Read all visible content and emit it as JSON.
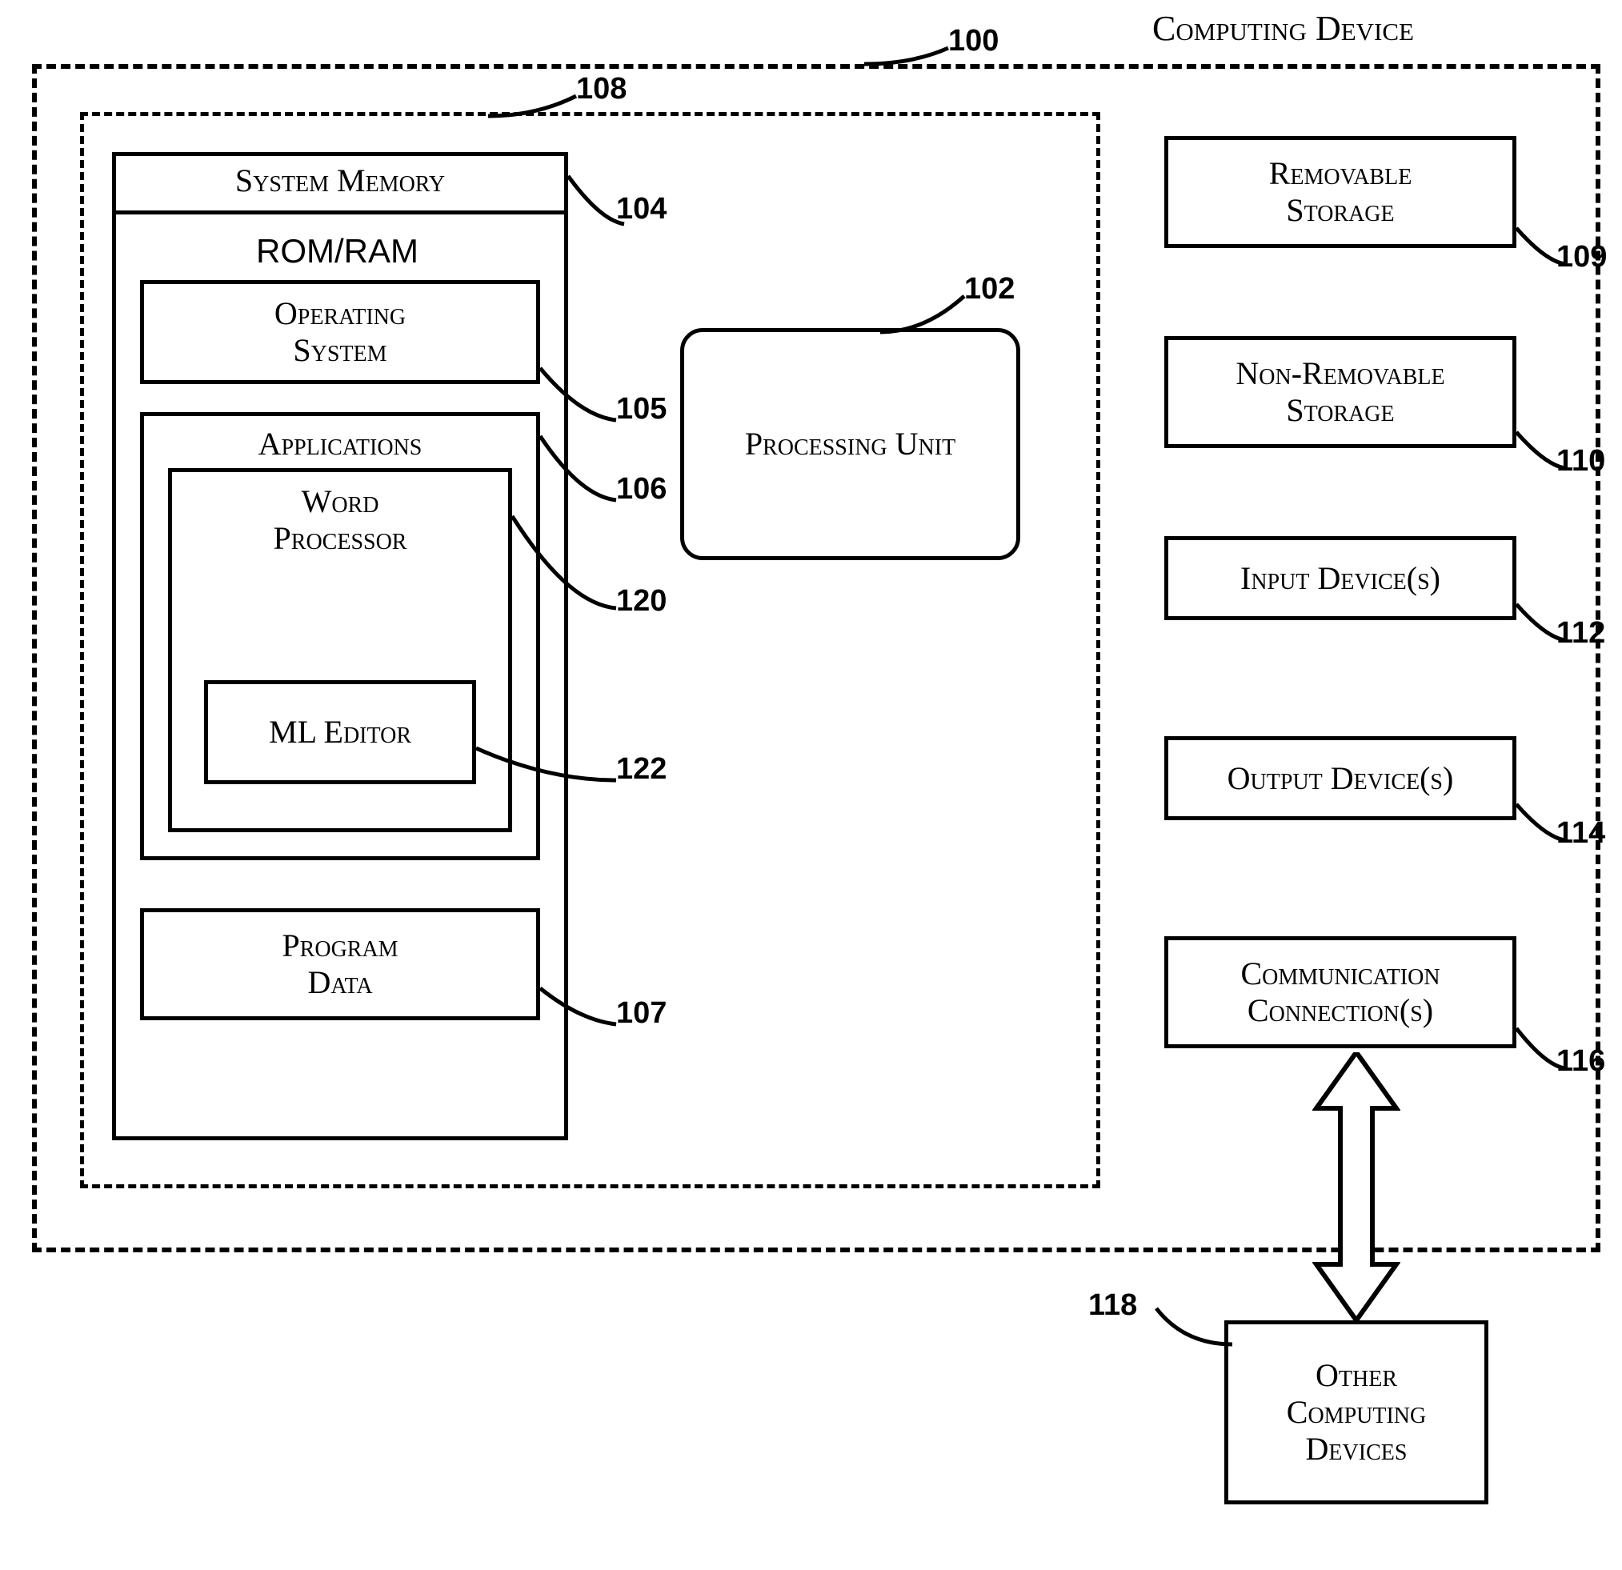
{
  "title": "Computing Device",
  "refs": {
    "r100": "100",
    "r102": "102",
    "r104": "104",
    "r105": "105",
    "r106": "106",
    "r107": "107",
    "r108": "108",
    "r109": "109",
    "r110": "110",
    "r112": "112",
    "r114": "114",
    "r116": "116",
    "r118": "118",
    "r120": "120",
    "r122": "122"
  },
  "blocks": {
    "system_memory": "System Memory",
    "rom_ram": "ROM/RAM",
    "operating_system": "Operating\nSystem",
    "applications": "Applications",
    "word_processor": "Word\nProcessor",
    "ml_editor": "ML Editor",
    "program_data": "Program\nData",
    "processing_unit": "Processing Unit",
    "removable_storage": "Removable\nStorage",
    "non_removable_storage": "Non-Removable\nStorage",
    "input_devices": "Input Device(s)",
    "output_devices": "Output Device(s)",
    "communication_connections": "Communication\nConnection(s)",
    "other_computing_devices": "Other\nComputing\nDevices"
  }
}
